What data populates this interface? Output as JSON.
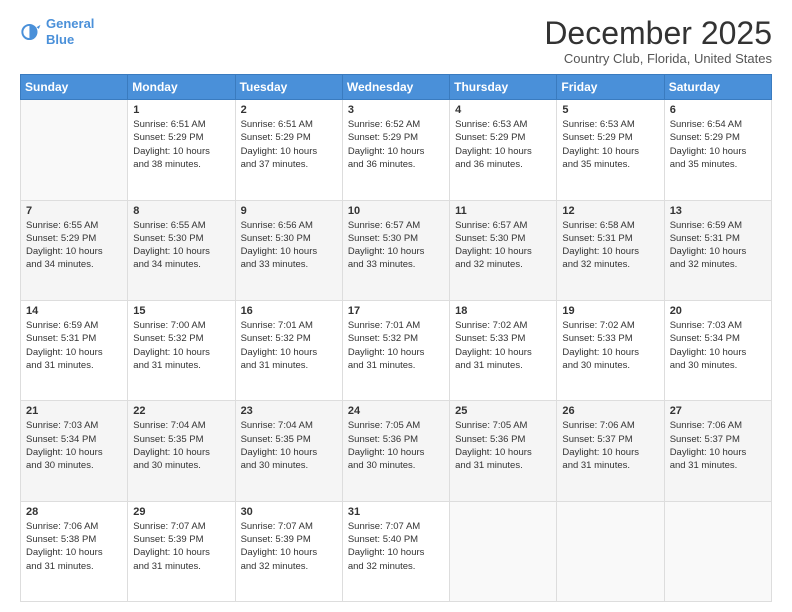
{
  "header": {
    "logo_line1": "General",
    "logo_line2": "Blue",
    "title": "December 2025",
    "subtitle": "Country Club, Florida, United States"
  },
  "weekdays": [
    "Sunday",
    "Monday",
    "Tuesday",
    "Wednesday",
    "Thursday",
    "Friday",
    "Saturday"
  ],
  "weeks": [
    [
      {
        "day": "",
        "info": ""
      },
      {
        "day": "1",
        "info": "Sunrise: 6:51 AM\nSunset: 5:29 PM\nDaylight: 10 hours\nand 38 minutes."
      },
      {
        "day": "2",
        "info": "Sunrise: 6:51 AM\nSunset: 5:29 PM\nDaylight: 10 hours\nand 37 minutes."
      },
      {
        "day": "3",
        "info": "Sunrise: 6:52 AM\nSunset: 5:29 PM\nDaylight: 10 hours\nand 36 minutes."
      },
      {
        "day": "4",
        "info": "Sunrise: 6:53 AM\nSunset: 5:29 PM\nDaylight: 10 hours\nand 36 minutes."
      },
      {
        "day": "5",
        "info": "Sunrise: 6:53 AM\nSunset: 5:29 PM\nDaylight: 10 hours\nand 35 minutes."
      },
      {
        "day": "6",
        "info": "Sunrise: 6:54 AM\nSunset: 5:29 PM\nDaylight: 10 hours\nand 35 minutes."
      }
    ],
    [
      {
        "day": "7",
        "info": "Sunrise: 6:55 AM\nSunset: 5:29 PM\nDaylight: 10 hours\nand 34 minutes."
      },
      {
        "day": "8",
        "info": "Sunrise: 6:55 AM\nSunset: 5:30 PM\nDaylight: 10 hours\nand 34 minutes."
      },
      {
        "day": "9",
        "info": "Sunrise: 6:56 AM\nSunset: 5:30 PM\nDaylight: 10 hours\nand 33 minutes."
      },
      {
        "day": "10",
        "info": "Sunrise: 6:57 AM\nSunset: 5:30 PM\nDaylight: 10 hours\nand 33 minutes."
      },
      {
        "day": "11",
        "info": "Sunrise: 6:57 AM\nSunset: 5:30 PM\nDaylight: 10 hours\nand 32 minutes."
      },
      {
        "day": "12",
        "info": "Sunrise: 6:58 AM\nSunset: 5:31 PM\nDaylight: 10 hours\nand 32 minutes."
      },
      {
        "day": "13",
        "info": "Sunrise: 6:59 AM\nSunset: 5:31 PM\nDaylight: 10 hours\nand 32 minutes."
      }
    ],
    [
      {
        "day": "14",
        "info": "Sunrise: 6:59 AM\nSunset: 5:31 PM\nDaylight: 10 hours\nand 31 minutes."
      },
      {
        "day": "15",
        "info": "Sunrise: 7:00 AM\nSunset: 5:32 PM\nDaylight: 10 hours\nand 31 minutes."
      },
      {
        "day": "16",
        "info": "Sunrise: 7:01 AM\nSunset: 5:32 PM\nDaylight: 10 hours\nand 31 minutes."
      },
      {
        "day": "17",
        "info": "Sunrise: 7:01 AM\nSunset: 5:32 PM\nDaylight: 10 hours\nand 31 minutes."
      },
      {
        "day": "18",
        "info": "Sunrise: 7:02 AM\nSunset: 5:33 PM\nDaylight: 10 hours\nand 31 minutes."
      },
      {
        "day": "19",
        "info": "Sunrise: 7:02 AM\nSunset: 5:33 PM\nDaylight: 10 hours\nand 30 minutes."
      },
      {
        "day": "20",
        "info": "Sunrise: 7:03 AM\nSunset: 5:34 PM\nDaylight: 10 hours\nand 30 minutes."
      }
    ],
    [
      {
        "day": "21",
        "info": "Sunrise: 7:03 AM\nSunset: 5:34 PM\nDaylight: 10 hours\nand 30 minutes."
      },
      {
        "day": "22",
        "info": "Sunrise: 7:04 AM\nSunset: 5:35 PM\nDaylight: 10 hours\nand 30 minutes."
      },
      {
        "day": "23",
        "info": "Sunrise: 7:04 AM\nSunset: 5:35 PM\nDaylight: 10 hours\nand 30 minutes."
      },
      {
        "day": "24",
        "info": "Sunrise: 7:05 AM\nSunset: 5:36 PM\nDaylight: 10 hours\nand 30 minutes."
      },
      {
        "day": "25",
        "info": "Sunrise: 7:05 AM\nSunset: 5:36 PM\nDaylight: 10 hours\nand 31 minutes."
      },
      {
        "day": "26",
        "info": "Sunrise: 7:06 AM\nSunset: 5:37 PM\nDaylight: 10 hours\nand 31 minutes."
      },
      {
        "day": "27",
        "info": "Sunrise: 7:06 AM\nSunset: 5:37 PM\nDaylight: 10 hours\nand 31 minutes."
      }
    ],
    [
      {
        "day": "28",
        "info": "Sunrise: 7:06 AM\nSunset: 5:38 PM\nDaylight: 10 hours\nand 31 minutes."
      },
      {
        "day": "29",
        "info": "Sunrise: 7:07 AM\nSunset: 5:39 PM\nDaylight: 10 hours\nand 31 minutes."
      },
      {
        "day": "30",
        "info": "Sunrise: 7:07 AM\nSunset: 5:39 PM\nDaylight: 10 hours\nand 32 minutes."
      },
      {
        "day": "31",
        "info": "Sunrise: 7:07 AM\nSunset: 5:40 PM\nDaylight: 10 hours\nand 32 minutes."
      },
      {
        "day": "",
        "info": ""
      },
      {
        "day": "",
        "info": ""
      },
      {
        "day": "",
        "info": ""
      }
    ]
  ]
}
